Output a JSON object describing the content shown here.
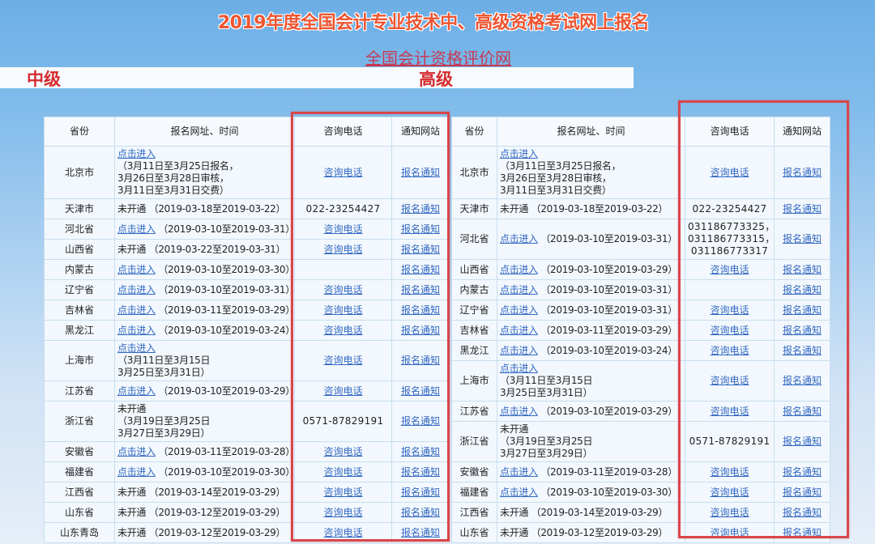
{
  "page": {
    "title": "2019年度全国会计专业技术中、高级资格考试网上报名",
    "site_link": "全国会计资格评价网",
    "level_labels": {
      "intermediate": "中级",
      "senior": "高级"
    }
  },
  "colors": {
    "title": "#ee5531",
    "site_link": "#c63a52",
    "level_label": "#d52b2e",
    "link": "#3569c2",
    "highlight_box": "#d8464a"
  },
  "tables": {
    "intermediate": {
      "headers": [
        "省份",
        "报名网址、时间",
        "咨询电话",
        "通知网站"
      ],
      "rows": [
        {
          "province": "北京市",
          "reg": [
            [
              {
                "link": "点击进入"
              }
            ],
            [
              "（3月11日至3月25日报名，"
            ],
            [
              "3月26日至3月28日审核，"
            ],
            [
              "3月11日至3月31日交费）"
            ]
          ],
          "phone": {
            "link": "咨询电话"
          },
          "notice": {
            "link": "报名通知"
          }
        },
        {
          "province": "天津市",
          "reg": [
            [
              "未开通 （2019-03-18至2019-03-22）"
            ]
          ],
          "phone": {
            "lines": [
              "022-23254427"
            ]
          },
          "notice": {
            "link": "报名通知"
          }
        },
        {
          "province": "河北省",
          "reg": [
            [
              {
                "link": "点击进入"
              },
              " （2019-03-10至2019-03-31）"
            ]
          ],
          "phone": {
            "link": "咨询电话"
          },
          "notice": {
            "link": "报名通知"
          }
        },
        {
          "province": "山西省",
          "reg": [
            [
              "未开通 （2019-03-22至2019-03-31）"
            ]
          ],
          "phone": {
            "link": "咨询电话"
          },
          "notice": {
            "link": "报名通知"
          }
        },
        {
          "province": "内蒙古",
          "reg": [
            [
              {
                "link": "点击进入"
              },
              " （2019-03-10至2019-03-30）"
            ]
          ],
          "phone": {},
          "notice": {
            "link": "报名通知"
          }
        },
        {
          "province": "辽宁省",
          "reg": [
            [
              {
                "link": "点击进入"
              },
              " （2019-03-10至2019-03-31）"
            ]
          ],
          "phone": {
            "link": "咨询电话"
          },
          "notice": {
            "link": "报名通知"
          }
        },
        {
          "province": "吉林省",
          "reg": [
            [
              {
                "link": "点击进入"
              },
              " （2019-03-11至2019-03-29）"
            ]
          ],
          "phone": {
            "link": "咨询电话"
          },
          "notice": {
            "link": "报名通知"
          }
        },
        {
          "province": "黑龙江",
          "reg": [
            [
              {
                "link": "点击进入"
              },
              " （2019-03-10至2019-03-24）"
            ]
          ],
          "phone": {
            "link": "咨询电话"
          },
          "notice": {
            "link": "报名通知"
          }
        },
        {
          "province": "上海市",
          "reg": [
            [
              {
                "link": "点击进入"
              }
            ],
            [
              "（3月11日至3月15日"
            ],
            [
              "3月25日至3月31日）"
            ]
          ],
          "phone": {
            "link": "咨询电话"
          },
          "notice": {
            "link": "报名通知"
          }
        },
        {
          "province": "江苏省",
          "reg": [
            [
              {
                "link": "点击进入"
              },
              " （2019-03-10至2019-03-29）"
            ]
          ],
          "phone": {
            "link": "咨询电话"
          },
          "notice": {
            "link": "报名通知"
          }
        },
        {
          "province": "浙江省",
          "reg": [
            [
              "未开通"
            ],
            [
              "（3月19日至3月25日"
            ],
            [
              "3月27日至3月29日）"
            ]
          ],
          "phone": {
            "lines": [
              "0571-87829191"
            ]
          },
          "notice": {
            "link": "报名通知"
          }
        },
        {
          "province": "安徽省",
          "reg": [
            [
              {
                "link": "点击进入"
              },
              " （2019-03-11至2019-03-28）"
            ]
          ],
          "phone": {
            "link": "咨询电话"
          },
          "notice": {
            "link": "报名通知"
          }
        },
        {
          "province": "福建省",
          "reg": [
            [
              {
                "link": "点击进入"
              },
              " （2019-03-10至2019-03-30）"
            ]
          ],
          "phone": {
            "link": "咨询电话"
          },
          "notice": {
            "link": "报名通知"
          }
        },
        {
          "province": "江西省",
          "reg": [
            [
              "未开通 （2019-03-14至2019-03-29）"
            ]
          ],
          "phone": {
            "link": "咨询电话"
          },
          "notice": {
            "link": "报名通知"
          }
        },
        {
          "province": "山东省",
          "reg": [
            [
              "未开通 （2019-03-12至2019-03-29）"
            ]
          ],
          "phone": {
            "link": "咨询电话"
          },
          "notice": {
            "link": "报名通知"
          }
        },
        {
          "province": "山东青岛",
          "reg": [
            [
              "未开通 （2019-03-12至2019-03-29）"
            ]
          ],
          "phone": {
            "link": "咨询电话"
          },
          "notice": {
            "link": "报名通知"
          }
        }
      ]
    },
    "senior": {
      "headers": [
        "省份",
        "报名网址、时间",
        "咨询电话",
        "通知网站"
      ],
      "rows": [
        {
          "province": "北京市",
          "reg": [
            [
              {
                "link": "点击进入"
              }
            ],
            [
              "（3月11日至3月25日报名，"
            ],
            [
              "3月26日至3月28日审核，"
            ],
            [
              "3月11日至3月31日交费）"
            ]
          ],
          "phone": {
            "link": "咨询电话"
          },
          "notice": {
            "link": "报名通知"
          }
        },
        {
          "province": "天津市",
          "reg": [
            [
              "未开通 （2019-03-18至2019-03-22）"
            ]
          ],
          "phone": {
            "lines": [
              "022-23254427"
            ]
          },
          "notice": {
            "link": "报名通知"
          }
        },
        {
          "province": "河北省",
          "reg": [
            [
              {
                "link": "点击进入"
              },
              " （2019-03-10至2019-03-31）"
            ]
          ],
          "phone": {
            "lines": [
              "031186773325，",
              "031186773315，",
              "031186773317"
            ]
          },
          "notice": {
            "link": "报名通知"
          }
        },
        {
          "province": "山西省",
          "reg": [
            [
              {
                "link": "点击进入"
              },
              " （2019-03-10至2019-03-29）"
            ]
          ],
          "phone": {
            "link": "咨询电话"
          },
          "notice": {
            "link": "报名通知"
          }
        },
        {
          "province": "内蒙古",
          "reg": [
            [
              {
                "link": "点击进入"
              },
              " （2019-03-10至2019-03-31）"
            ]
          ],
          "phone": {},
          "notice": {
            "link": "报名通知"
          }
        },
        {
          "province": "辽宁省",
          "reg": [
            [
              {
                "link": "点击进入"
              },
              " （2019-03-10至2019-03-31）"
            ]
          ],
          "phone": {
            "link": "咨询电话"
          },
          "notice": {
            "link": "报名通知"
          }
        },
        {
          "province": "吉林省",
          "reg": [
            [
              {
                "link": "点击进入"
              },
              " （2019-03-11至2019-03-29）"
            ]
          ],
          "phone": {
            "link": "咨询电话"
          },
          "notice": {
            "link": "报名通知"
          }
        },
        {
          "province": "黑龙江",
          "reg": [
            [
              {
                "link": "点击进入"
              },
              " （2019-03-10至2019-03-24）"
            ]
          ],
          "phone": {
            "link": "咨询电话"
          },
          "notice": {
            "link": "报名通知"
          }
        },
        {
          "province": "上海市",
          "reg": [
            [
              {
                "link": "点击进入"
              }
            ],
            [
              "（3月11日至3月15日"
            ],
            [
              "3月25日至3月31日）"
            ]
          ],
          "phone": {
            "link": "咨询电话"
          },
          "notice": {
            "link": "报名通知"
          }
        },
        {
          "province": "江苏省",
          "reg": [
            [
              {
                "link": "点击进入"
              },
              " （2019-03-10至2019-03-29）"
            ]
          ],
          "phone": {
            "link": "咨询电话"
          },
          "notice": {
            "link": "报名通知"
          }
        },
        {
          "province": "浙江省",
          "reg": [
            [
              "未开通"
            ],
            [
              "（3月19日至3月25日"
            ],
            [
              "3月27日至3月29日）"
            ]
          ],
          "phone": {
            "lines": [
              "0571-87829191"
            ]
          },
          "notice": {
            "link": "报名通知"
          }
        },
        {
          "province": "安徽省",
          "reg": [
            [
              {
                "link": "点击进入"
              },
              " （2019-03-11至2019-03-28）"
            ]
          ],
          "phone": {
            "link": "咨询电话"
          },
          "notice": {
            "link": "报名通知"
          }
        },
        {
          "province": "福建省",
          "reg": [
            [
              {
                "link": "点击进入"
              },
              " （2019-03-10至2019-03-30）"
            ]
          ],
          "phone": {
            "link": "咨询电话"
          },
          "notice": {
            "link": "报名通知"
          }
        },
        {
          "province": "江西省",
          "reg": [
            [
              "未开通 （2019-03-14至2019-03-29）"
            ]
          ],
          "phone": {
            "link": "咨询电话"
          },
          "notice": {
            "link": "报名通知"
          }
        },
        {
          "province": "山东省",
          "reg": [
            [
              "未开通 （2019-03-12至2019-03-29）"
            ]
          ],
          "phone": {
            "link": "咨询电话"
          },
          "notice": {
            "link": "报名通知"
          }
        }
      ]
    }
  }
}
